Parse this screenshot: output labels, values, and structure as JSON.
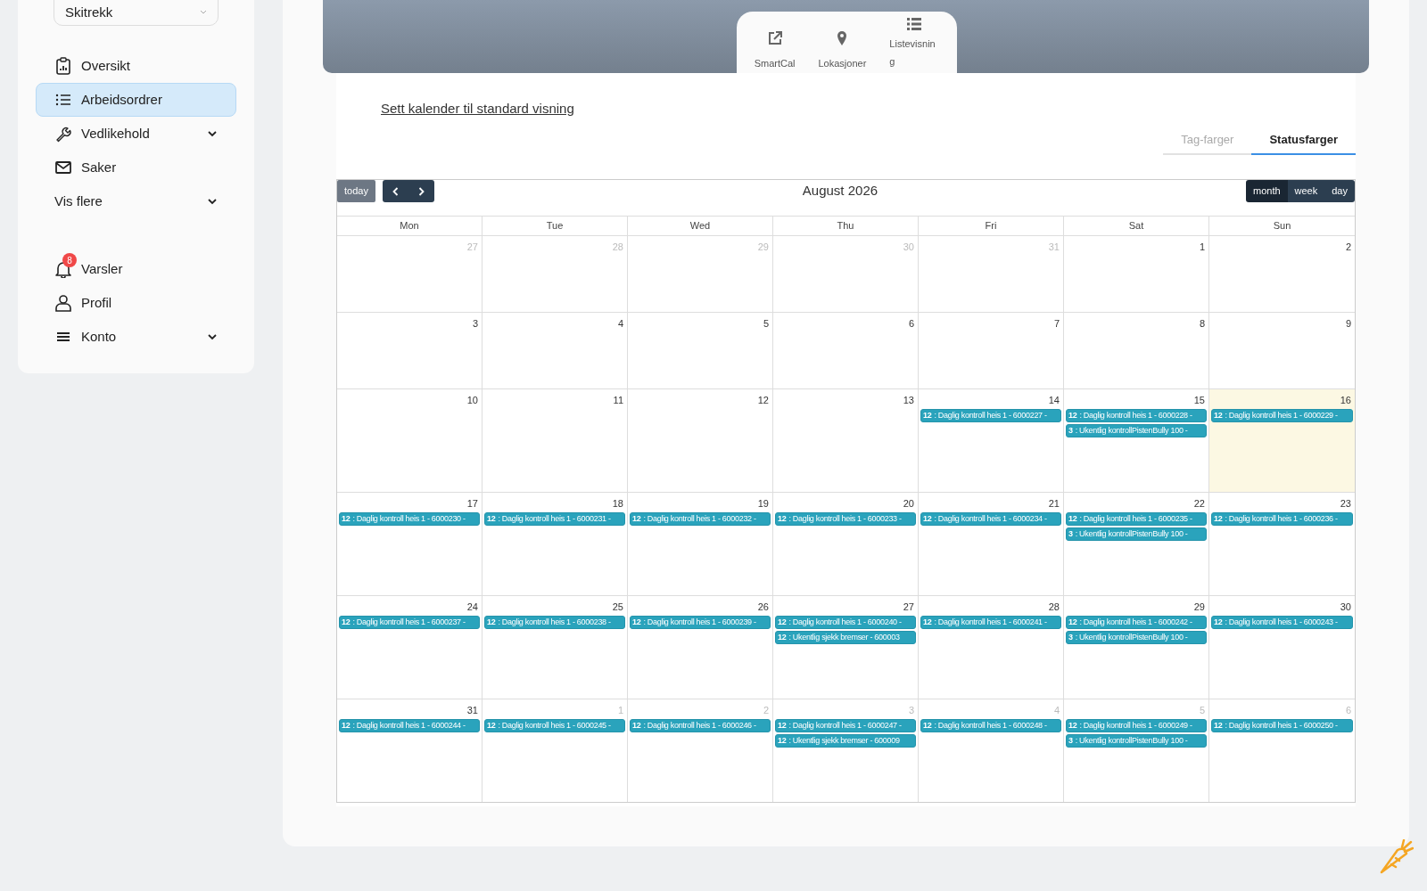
{
  "sidebar": {
    "select": {
      "value": "Skitrekk"
    },
    "items": [
      {
        "kind": "clipboard",
        "label": "Oversikt",
        "selected": false,
        "expandable": false
      },
      {
        "kind": "list",
        "label": "Arbeidsordrer",
        "selected": true,
        "expandable": false
      },
      {
        "kind": "wrench",
        "label": "Vedlikehold",
        "selected": false,
        "expandable": true
      },
      {
        "kind": "mail",
        "label": "Saker",
        "selected": false,
        "expandable": false
      },
      {
        "kind": "plain",
        "label": "Vis flere",
        "selected": false,
        "expandable": true
      }
    ],
    "bottom_items": [
      {
        "kind": "bell",
        "label": "Varsler",
        "badge": "8",
        "expandable": false
      },
      {
        "kind": "user",
        "label": "Profil",
        "expandable": false
      },
      {
        "kind": "menu",
        "label": "Konto",
        "expandable": true
      }
    ]
  },
  "view_tabs": [
    {
      "kind": "external",
      "label": "SmartCal"
    },
    {
      "kind": "pin",
      "label": "Lokasjoner"
    },
    {
      "kind": "list",
      "label": "Listevisning"
    }
  ],
  "reset_link": "Sett kalender til standard visning",
  "color_tabs": [
    {
      "label": "Tag-farger",
      "selected": false
    },
    {
      "label": "Statusfarger",
      "selected": true
    }
  ],
  "calendar": {
    "today_button": "today",
    "title": "August 2026",
    "views": [
      {
        "label": "month",
        "selected": true
      },
      {
        "label": "week",
        "selected": false
      },
      {
        "label": "day",
        "selected": false
      }
    ],
    "weekdays": [
      "Mon",
      "Tue",
      "Wed",
      "Thu",
      "Fri",
      "Sat",
      "Sun"
    ],
    "weeks": [
      [
        {
          "day": "27",
          "muted": true
        },
        {
          "day": "28",
          "muted": true
        },
        {
          "day": "29",
          "muted": true
        },
        {
          "day": "30",
          "muted": true
        },
        {
          "day": "31",
          "muted": true
        },
        {
          "day": "1"
        },
        {
          "day": "2"
        }
      ],
      [
        {
          "day": "3"
        },
        {
          "day": "4"
        },
        {
          "day": "5"
        },
        {
          "day": "6"
        },
        {
          "day": "7"
        },
        {
          "day": "8"
        },
        {
          "day": "9"
        }
      ],
      [
        {
          "day": "10"
        },
        {
          "day": "11"
        },
        {
          "day": "12"
        },
        {
          "day": "13"
        },
        {
          "day": "14",
          "events": [
            {
              "time": "12",
              "title": ": Daglig kontroll heis 1 - 6000227 -"
            }
          ]
        },
        {
          "day": "15",
          "events": [
            {
              "time": "12",
              "title": ": Daglig kontroll heis 1 - 6000228 -"
            },
            {
              "time": "3",
              "title": ": Ukentlig kontrollPistenBully 100 -"
            }
          ]
        },
        {
          "day": "16",
          "today": true,
          "events": [
            {
              "time": "12",
              "title": ": Daglig kontroll heis 1 - 6000229 -"
            }
          ]
        }
      ],
      [
        {
          "day": "17",
          "events": [
            {
              "time": "12",
              "title": ": Daglig kontroll heis 1 - 6000230 -"
            }
          ]
        },
        {
          "day": "18",
          "events": [
            {
              "time": "12",
              "title": ": Daglig kontroll heis 1 - 6000231 -"
            }
          ]
        },
        {
          "day": "19",
          "events": [
            {
              "time": "12",
              "title": ": Daglig kontroll heis 1 - 6000232 -"
            }
          ]
        },
        {
          "day": "20",
          "events": [
            {
              "time": "12",
              "title": ": Daglig kontroll heis 1 - 6000233 -"
            }
          ]
        },
        {
          "day": "21",
          "events": [
            {
              "time": "12",
              "title": ": Daglig kontroll heis 1 - 6000234 -"
            }
          ]
        },
        {
          "day": "22",
          "events": [
            {
              "time": "12",
              "title": ": Daglig kontroll heis 1 - 6000235 -"
            },
            {
              "time": "3",
              "title": ": Ukentlig kontrollPistenBully 100 -"
            }
          ]
        },
        {
          "day": "23",
          "events": [
            {
              "time": "12",
              "title": ": Daglig kontroll heis 1 - 6000236 -"
            }
          ]
        }
      ],
      [
        {
          "day": "24",
          "events": [
            {
              "time": "12",
              "title": ": Daglig kontroll heis 1 - 6000237 -"
            }
          ]
        },
        {
          "day": "25",
          "events": [
            {
              "time": "12",
              "title": ": Daglig kontroll heis 1 - 6000238 -"
            }
          ]
        },
        {
          "day": "26",
          "events": [
            {
              "time": "12",
              "title": ": Daglig kontroll heis 1 - 6000239 -"
            }
          ]
        },
        {
          "day": "27",
          "events": [
            {
              "time": "12",
              "title": ": Daglig kontroll heis 1 - 6000240 -"
            },
            {
              "time": "12",
              "title": ": Ukentlig sjekk bremser - 600003"
            }
          ]
        },
        {
          "day": "28",
          "events": [
            {
              "time": "12",
              "title": ": Daglig kontroll heis 1 - 6000241 -"
            }
          ]
        },
        {
          "day": "29",
          "events": [
            {
              "time": "12",
              "title": ": Daglig kontroll heis 1 - 6000242 -"
            },
            {
              "time": "3",
              "title": ": Ukentlig kontrollPistenBully 100 -"
            }
          ]
        },
        {
          "day": "30",
          "events": [
            {
              "time": "12",
              "title": ": Daglig kontroll heis 1 - 6000243 -"
            }
          ]
        }
      ],
      [
        {
          "day": "31",
          "events": [
            {
              "time": "12",
              "title": ": Daglig kontroll heis 1 - 6000244 -"
            }
          ]
        },
        {
          "day": "1",
          "muted": true,
          "events": [
            {
              "time": "12",
              "title": ": Daglig kontroll heis 1 - 6000245 -"
            }
          ]
        },
        {
          "day": "2",
          "muted": true,
          "events": [
            {
              "time": "12",
              "title": ": Daglig kontroll heis 1 - 6000246 -"
            }
          ]
        },
        {
          "day": "3",
          "muted": true,
          "events": [
            {
              "time": "12",
              "title": ": Daglig kontroll heis 1 - 6000247 -"
            },
            {
              "time": "12",
              "title": ": Ukentlig sjekk bremser - 600009"
            }
          ]
        },
        {
          "day": "4",
          "muted": true,
          "events": [
            {
              "time": "12",
              "title": ": Daglig kontroll heis 1 - 6000248 -"
            }
          ]
        },
        {
          "day": "5",
          "muted": true,
          "events": [
            {
              "time": "12",
              "title": ": Daglig kontroll heis 1 - 6000249 -"
            },
            {
              "time": "3",
              "title": ": Ukentlig kontrollPistenBully 100 -"
            }
          ]
        },
        {
          "day": "6",
          "muted": true,
          "events": [
            {
              "time": "12",
              "title": ": Daglig kontroll heis 1 - 6000250 -"
            }
          ]
        }
      ]
    ]
  }
}
